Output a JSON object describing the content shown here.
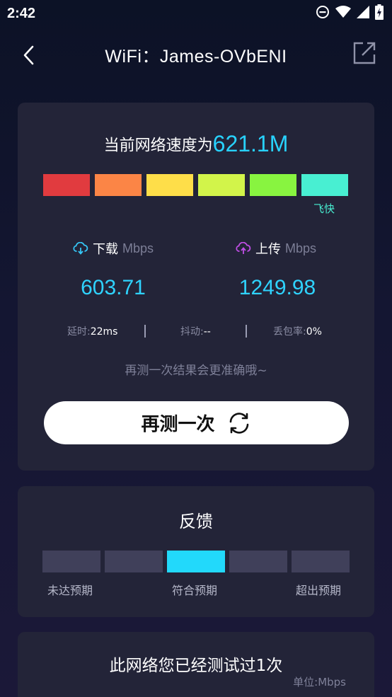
{
  "status_bar": {
    "time": "2:42",
    "icons": [
      "dnd-icon",
      "wifi-icon",
      "signal-icon",
      "battery-icon"
    ]
  },
  "appbar": {
    "title": "WiFi：James-OVbENI",
    "back_icon": "chevron-left-icon",
    "share_icon": "share-icon"
  },
  "speed": {
    "prefix": "当前网络速度为",
    "value": "621.1M",
    "level_label": "飞快"
  },
  "scale_colors": [
    "#e13b3f",
    "#fb8546",
    "#fede49",
    "#d2f44a",
    "#88f440",
    "#48efd2"
  ],
  "download": {
    "label": "下载",
    "unit": "Mbps",
    "value": "603.71",
    "icon": "cloud-download-icon"
  },
  "upload": {
    "label": "上传",
    "unit": "Mbps",
    "value": "1249.98",
    "icon": "cloud-upload-icon"
  },
  "stats": {
    "latency_label": "延时:",
    "latency_value": "22ms",
    "jitter_label": "抖动:",
    "jitter_value": "--",
    "loss_label": "丢包率:",
    "loss_value": "0%"
  },
  "hint": "再测一次结果会更准确哦~",
  "retest": {
    "label": "再测一次",
    "icon": "refresh-icon"
  },
  "feedback": {
    "title": "反馈",
    "segments": 5,
    "selected_index": 2,
    "labels": [
      "未达预期",
      "符合预期",
      "超出预期"
    ]
  },
  "history": {
    "title": "此网络您已经测试过1次",
    "unit": "单位:Mbps"
  },
  "colors": {
    "accent": "#28d2ff",
    "card": "#232438",
    "feedback_active": "#22d9fb",
    "upload_icon": "#c04ee6",
    "download_icon": "#35c6f5"
  }
}
